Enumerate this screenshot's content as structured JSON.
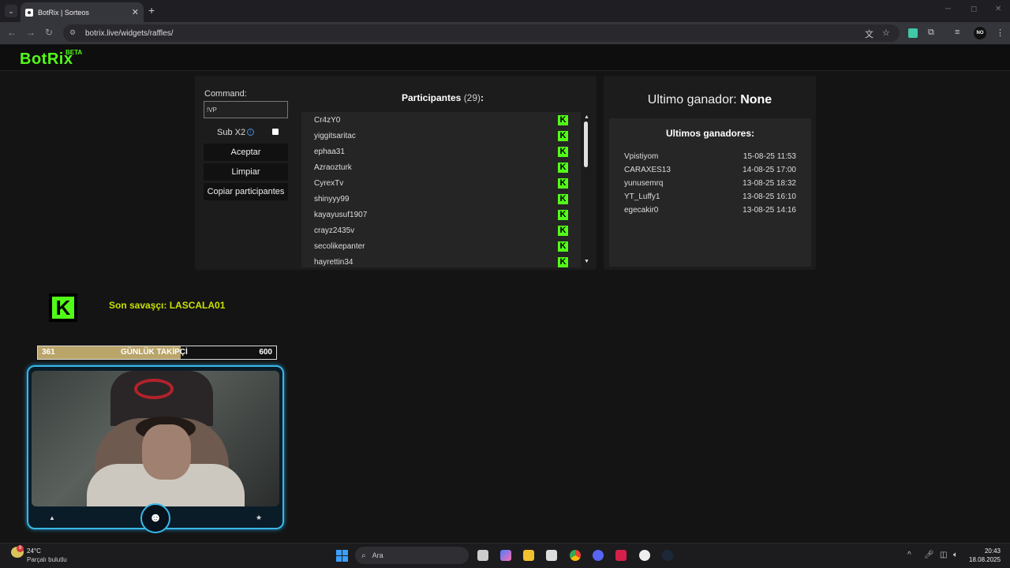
{
  "browser": {
    "tab_title": "BotRix | Sorteos",
    "tab_close": "✕",
    "new_tab": "+",
    "url": "botrix.live/widgets/raffles/",
    "profile_initials": "NO"
  },
  "header": {
    "logo": "BotRix",
    "beta": "BETA"
  },
  "raffle": {
    "command_label": "Command:",
    "command_value": "!VP",
    "sub_label": "Sub X2",
    "sub_checked": false,
    "buttons": {
      "accept": "Aceptar",
      "clear": "Limpiar",
      "copy": "Copiar participantes"
    },
    "participants_title": "Participantes",
    "participants_count": "(29)",
    "participants_suffix": ":",
    "participants": [
      "Cr4zY0",
      "yiggitsaritac",
      "ephaa31",
      "Azraozturk",
      "CyrexTv",
      "shinyyy99",
      "kayayusuf1907",
      "crayz2435v",
      "secolikepanter",
      "hayrettin34"
    ],
    "platform_badge": "K",
    "platform_color": "#53fc18"
  },
  "winners": {
    "last_label": "Ultimo ganador:",
    "last_value": "None",
    "list_title": "Ultimos ganadores:",
    "list": [
      {
        "name": "Vpistiyom",
        "date": "15-08-25 11:53"
      },
      {
        "name": "CARAXES13",
        "date": "14-08-25 17:00"
      },
      {
        "name": "yunusemrq",
        "date": "13-08-25 18:32"
      },
      {
        "name": "YT_Luffy1",
        "date": "13-08-25 16:10"
      },
      {
        "name": "egecakir0",
        "date": "13-08-25 14:16"
      }
    ]
  },
  "overlay": {
    "kick_badge": "K",
    "last_warrior": "Son savaşçı: LASCALA01",
    "follow_goal": {
      "current": "361",
      "label": "GÜNLÜK TAKİPÇİ",
      "target": "600",
      "progress": 0.6
    }
  },
  "taskbar": {
    "temperature": "24°C",
    "condition": "Parçalı bulutlu",
    "weather_badge": "9",
    "search_placeholder": "Ara",
    "time": "20:43",
    "date": "18.08.2025"
  }
}
